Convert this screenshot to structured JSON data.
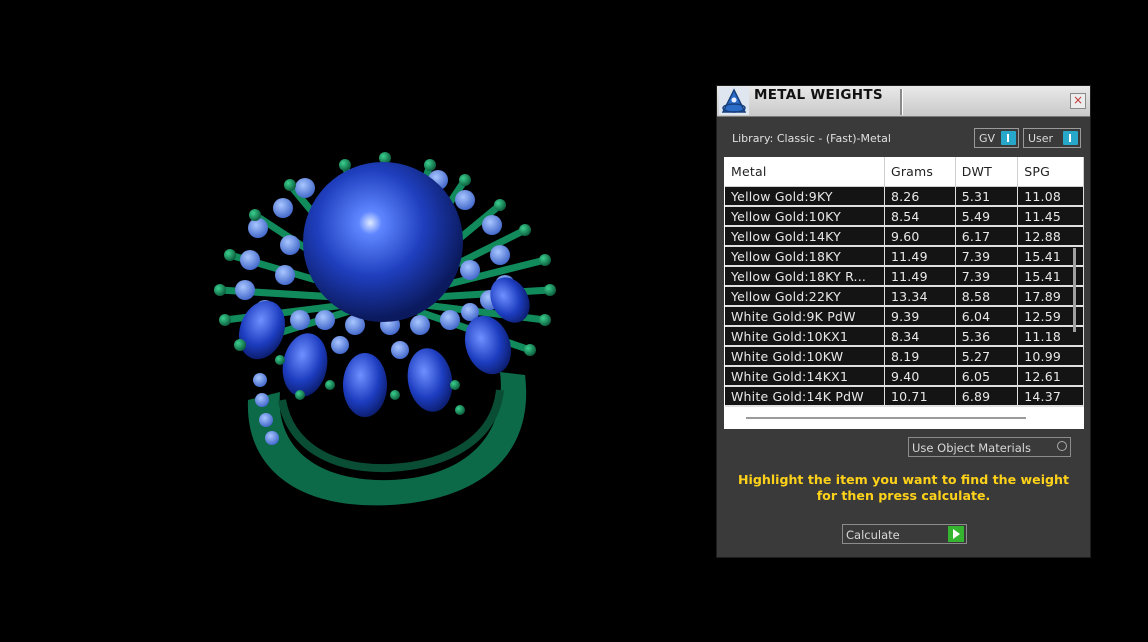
{
  "panel": {
    "title": "METAL WEIGHTS",
    "close_glyph": "×",
    "library_label": "Library: Classic - (Fast)-Metal",
    "toggles": {
      "gv": "GV",
      "user": "User"
    },
    "columns": [
      "Metal",
      "Grams",
      "DWT",
      "SPG"
    ],
    "rows": [
      [
        "Yellow Gold:9KY",
        "8.26",
        "5.31",
        "11.08"
      ],
      [
        "Yellow Gold:10KY",
        "8.54",
        "5.49",
        "11.45"
      ],
      [
        "Yellow Gold:14KY",
        "9.60",
        "6.17",
        "12.88"
      ],
      [
        "Yellow Gold:18KY",
        "11.49",
        "7.39",
        "15.41"
      ],
      [
        "Yellow Gold:18KY R...",
        "11.49",
        "7.39",
        "15.41"
      ],
      [
        "Yellow Gold:22KY",
        "13.34",
        "8.58",
        "17.89"
      ],
      [
        "White Gold:9K PdW",
        "9.39",
        "6.04",
        "12.59"
      ],
      [
        "White Gold:10KX1",
        "8.34",
        "5.36",
        "11.18"
      ],
      [
        "White Gold:10KW",
        "8.19",
        "5.27",
        "10.99"
      ],
      [
        "White Gold:14KX1",
        "9.40",
        "6.05",
        "12.61"
      ],
      [
        "White Gold:14K PdW",
        "10.71",
        "6.89",
        "14.37"
      ]
    ],
    "materials_dropdown": "Use Object Materials",
    "instructions": "Highlight the item you want to find the weight for then press calculate.",
    "calculate_label": "Calculate"
  },
  "icons": [
    "app-logo-icon",
    "close-icon",
    "toggle-knob-icon",
    "dropdown-icon",
    "play-icon"
  ],
  "colors": {
    "panel_bg": "#3a3a3a",
    "instructions": "#ffd21a",
    "toggle_knob": "#27a7c9",
    "calculate_play": "#35b430",
    "ring_band": "#0f6e4c",
    "ring_pearl": "#1842b0"
  }
}
